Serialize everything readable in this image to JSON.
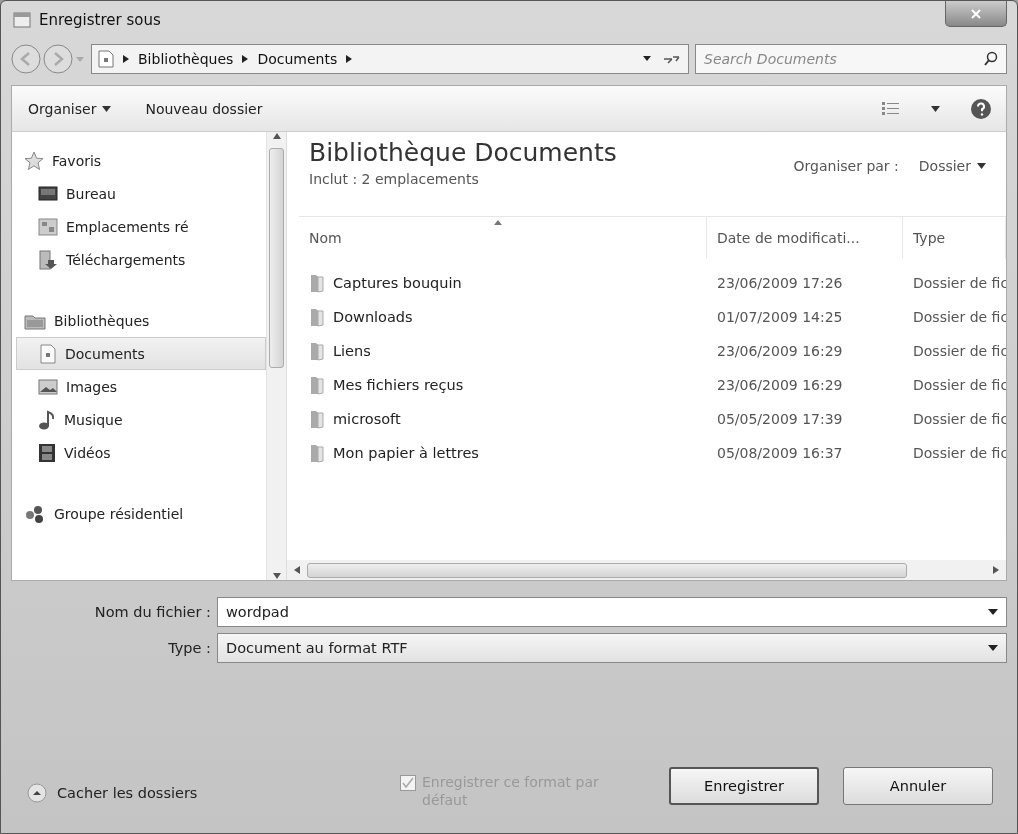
{
  "window": {
    "title": "Enregistrer sous"
  },
  "address_bar": {
    "path": [
      "Bibliothèques",
      "Documents"
    ],
    "search_placeholder": "Search Documents"
  },
  "toolbar": {
    "organise": "Organiser",
    "new_folder": "Nouveau dossier"
  },
  "sidebar": {
    "groups": [
      {
        "label": "Favoris",
        "children": [
          {
            "label": "Bureau",
            "selected": false
          },
          {
            "label": "Emplacements ré",
            "selected": false
          },
          {
            "label": "Téléchargements",
            "selected": false
          }
        ]
      },
      {
        "label": "Bibliothèques",
        "children": [
          {
            "label": "Documents",
            "selected": true
          },
          {
            "label": "Images",
            "selected": false
          },
          {
            "label": "Musique",
            "selected": false
          },
          {
            "label": "Vidéos",
            "selected": false
          }
        ]
      },
      {
        "label": "Groupe résidentiel"
      }
    ]
  },
  "library": {
    "title": "Bibliothèque Documents",
    "subtitle": "Inclut :  2 emplacements",
    "arrange_label": "Organiser par :",
    "arrange_value": "Dossier"
  },
  "table": {
    "columns": [
      "Nom",
      "Date de modificati...",
      "Type"
    ],
    "rows": [
      {
        "name": "Captures bouquin",
        "date": "23/06/2009 17:26",
        "type": "Dossier de fic"
      },
      {
        "name": "Downloads",
        "date": "01/07/2009 14:25",
        "type": "Dossier de fic"
      },
      {
        "name": "Liens",
        "date": "23/06/2009 16:29",
        "type": "Dossier de fic"
      },
      {
        "name": "Mes fichiers reçus",
        "date": "23/06/2009 16:29",
        "type": "Dossier de fic"
      },
      {
        "name": "microsoft",
        "date": "05/05/2009 17:39",
        "type": "Dossier de fic"
      },
      {
        "name": "Mon papier à lettres",
        "date": "05/08/2009 16:37",
        "type": "Dossier de fic"
      }
    ]
  },
  "form": {
    "filename_label": "Nom du fichier :",
    "filename": "wordpad",
    "type_label": "Type :",
    "type": "Document au format RTF"
  },
  "footer": {
    "hide_folders": "Cacher les dossiers",
    "default_format": {
      "label": "Enregistrer ce format par défaut",
      "checked": true,
      "disabled": true
    },
    "buttons": [
      "Enregistrer",
      "Annuler"
    ]
  }
}
